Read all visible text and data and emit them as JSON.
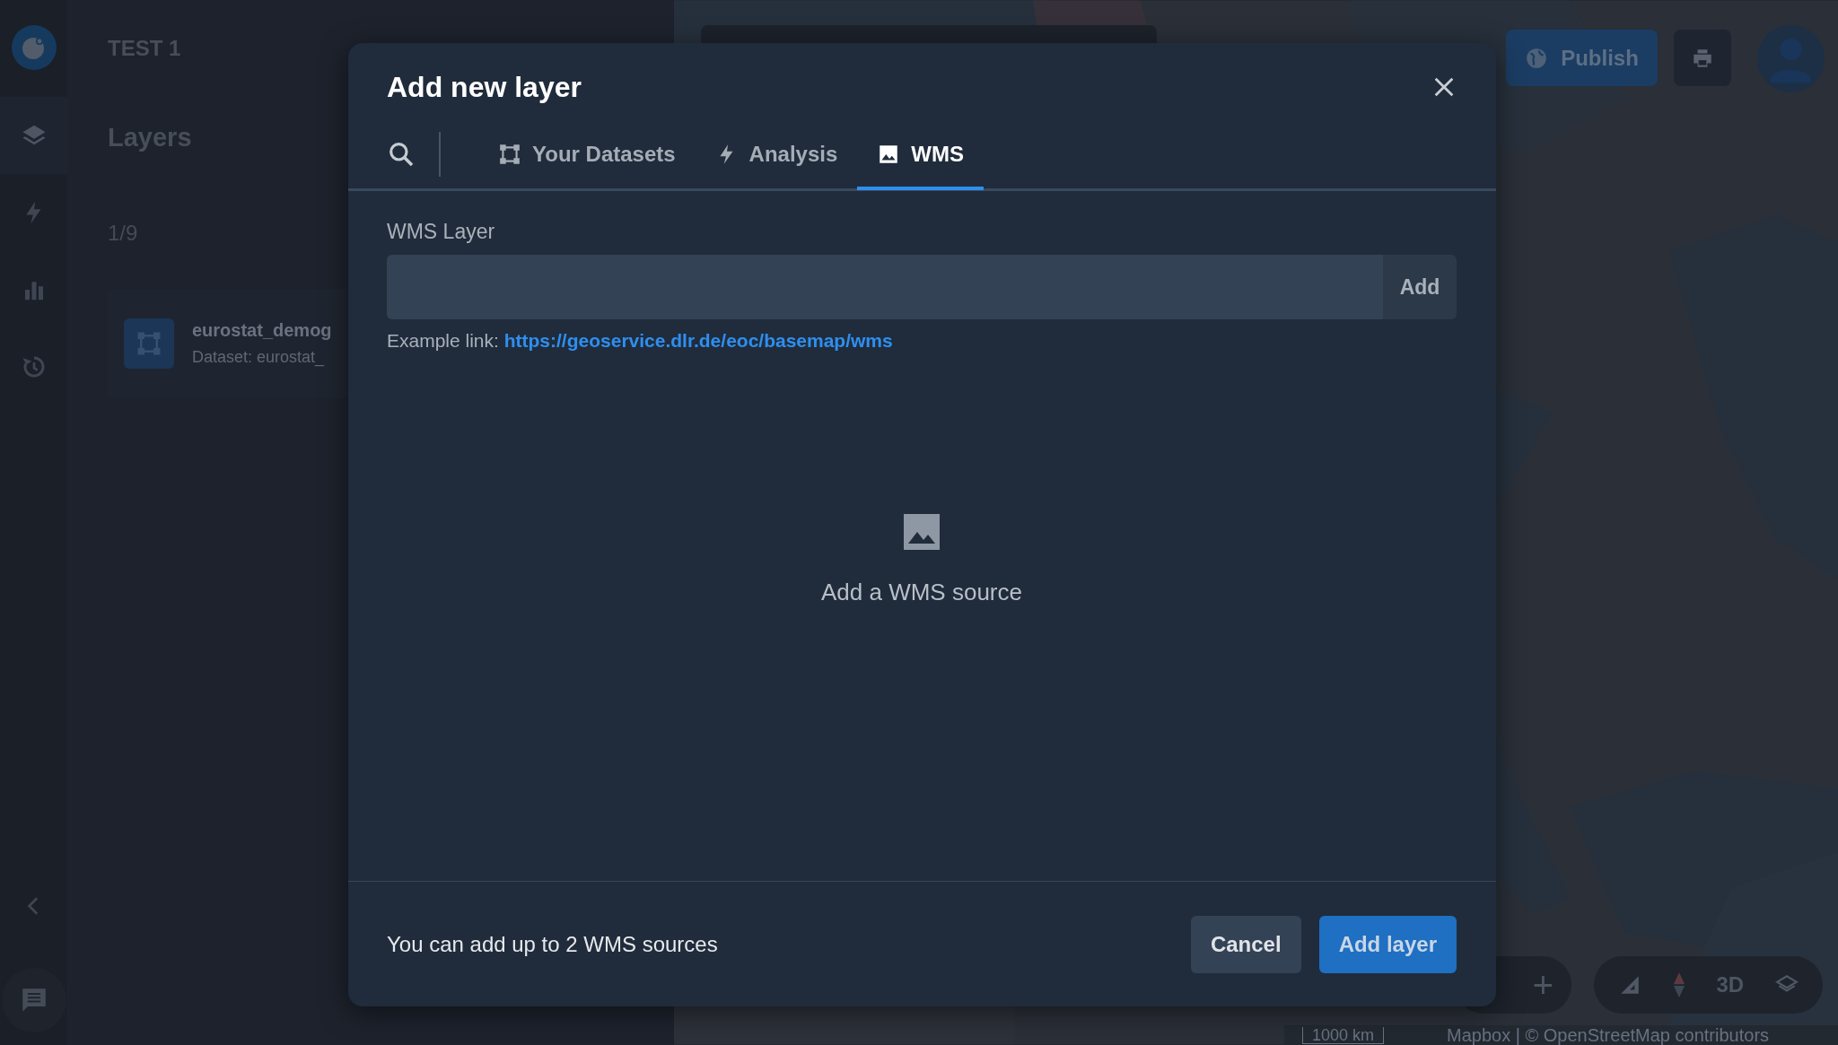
{
  "rail": {
    "items": [
      {
        "kind": "layers",
        "selected": true
      },
      {
        "kind": "analysis",
        "selected": false
      },
      {
        "kind": "charts",
        "selected": false
      },
      {
        "kind": "history",
        "selected": false
      }
    ]
  },
  "project": {
    "title": "TEST 1"
  },
  "layers_panel": {
    "heading": "Layers",
    "count": "1/9",
    "layers": [
      {
        "name": "eurostat_demog",
        "subtitle": "Dataset: eurostat_"
      }
    ]
  },
  "map": {
    "kind": "picture",
    "publish_button": "Publish",
    "zoom_in": "+",
    "view_mode": "3D",
    "scale": "1000 km",
    "attribution": "Mapbox | © OpenStreetMap contributors"
  },
  "dialog": {
    "title": "Add new layer",
    "tabs": [
      {
        "kind": "datasets",
        "label": "Your Datasets",
        "selected": false
      },
      {
        "kind": "analysis",
        "label": "Analysis",
        "selected": false
      },
      {
        "kind": "wms",
        "label": "WMS",
        "selected": true
      }
    ],
    "field": {
      "label": "WMS Layer",
      "button": "Add"
    },
    "example": {
      "prefix": "Example link:",
      "link": "https://geoservice.dlr.de/eoc/basemap/wms"
    },
    "empty_state": {
      "text": "Add a WMS source"
    },
    "footer_note": "You can add up to 2 WMS sources",
    "buttons": [
      {
        "kind": "secondary",
        "label": "Cancel"
      },
      {
        "kind": "primary",
        "label": "Add layer"
      }
    ]
  }
}
